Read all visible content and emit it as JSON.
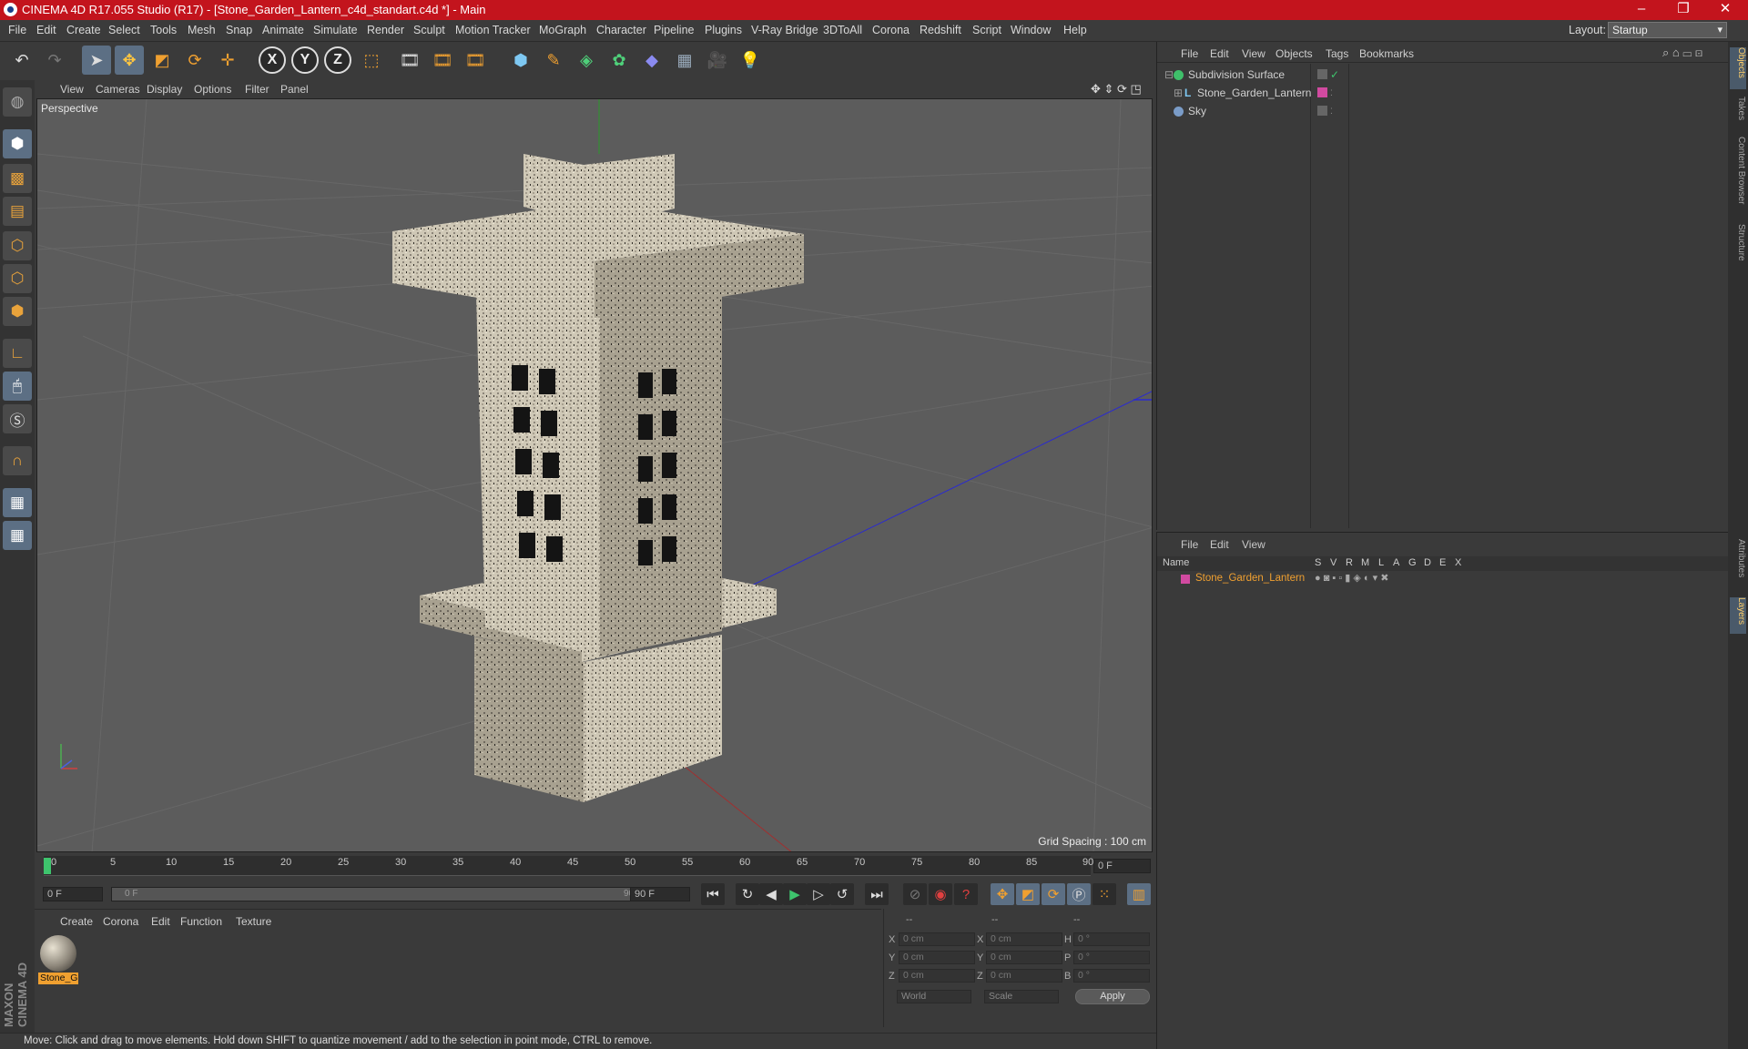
{
  "title_bar": {
    "title": "CINEMA 4D R17.055 Studio (R17) - [Stone_Garden_Lantern_c4d_standart.c4d *] - Main"
  },
  "menu": [
    "File",
    "Edit",
    "Create",
    "Select",
    "Tools",
    "Mesh",
    "Snap",
    "Animate",
    "Simulate",
    "Render",
    "Sculpt",
    "Motion Tracker",
    "MoGraph",
    "Character",
    "Pipeline",
    "Plugins",
    "V-Ray Bridge",
    "3DToAll",
    "Corona",
    "Redshift",
    "Script",
    "Window",
    "Help"
  ],
  "layout": {
    "label": "Layout:",
    "value": "Startup"
  },
  "viewport": {
    "menu": [
      "View",
      "Cameras",
      "Display",
      "Options",
      "Filter",
      "Panel"
    ],
    "camera_label": "Perspective",
    "grid_info": "Grid Spacing : 100 cm"
  },
  "timeline": {
    "ticks": [
      "0",
      "5",
      "10",
      "15",
      "20",
      "25",
      "30",
      "35",
      "40",
      "45",
      "50",
      "55",
      "60",
      "65",
      "70",
      "75",
      "80",
      "85",
      "90"
    ],
    "current_frame_field": "0 F",
    "start_field": "0 F",
    "range_start": "0 F",
    "range_end": "90 F",
    "end_field": "90 F"
  },
  "material_manager": {
    "menu": [
      "Create",
      "Corona",
      "Edit",
      "Function",
      "Texture"
    ],
    "material_name": "Stone_G"
  },
  "coordinates": {
    "col_labels": [
      "--",
      "--",
      "--"
    ],
    "rows": [
      {
        "a": "X",
        "av": "0 cm",
        "b": "X",
        "bv": "0 cm",
        "c": "H",
        "cv": "0 °"
      },
      {
        "a": "Y",
        "av": "0 cm",
        "b": "Y",
        "bv": "0 cm",
        "c": "P",
        "cv": "0 °"
      },
      {
        "a": "Z",
        "av": "0 cm",
        "b": "Z",
        "bv": "0 cm",
        "c": "B",
        "cv": "0 °"
      }
    ],
    "mode": "World",
    "scale": "Scale",
    "apply": "Apply"
  },
  "object_manager": {
    "menu": [
      "File",
      "Edit",
      "View",
      "Objects",
      "Tags",
      "Bookmarks"
    ],
    "objects": [
      {
        "name": "Subdivision Surface",
        "color": "#3fbf6a"
      },
      {
        "name": "Stone_Garden_Lantern",
        "color": "#d14aa0"
      },
      {
        "name": "Sky",
        "color": "#7a9cc8"
      }
    ]
  },
  "layer_manager": {
    "menu": [
      "File",
      "Edit",
      "View"
    ],
    "columns": [
      "Name",
      "S",
      "V",
      "R",
      "M",
      "L",
      "A",
      "G",
      "D",
      "E",
      "X"
    ],
    "layers": [
      {
        "name": "Stone_Garden_Lantern",
        "color": "#d14aa0"
      }
    ]
  },
  "right_tabs": [
    "Objects",
    "Takes",
    "Content Browser",
    "Structure",
    "Attributes",
    "Layers"
  ],
  "status": "Move: Click and drag to move elements. Hold down SHIFT to quantize movement / add to the selection in point mode, CTRL to remove.",
  "brand": "MAXON CINEMA 4D",
  "colors": {
    "title_red": "#c3141d",
    "accent_orange": "#f0a030",
    "selection_blue": "#5c6f84"
  }
}
